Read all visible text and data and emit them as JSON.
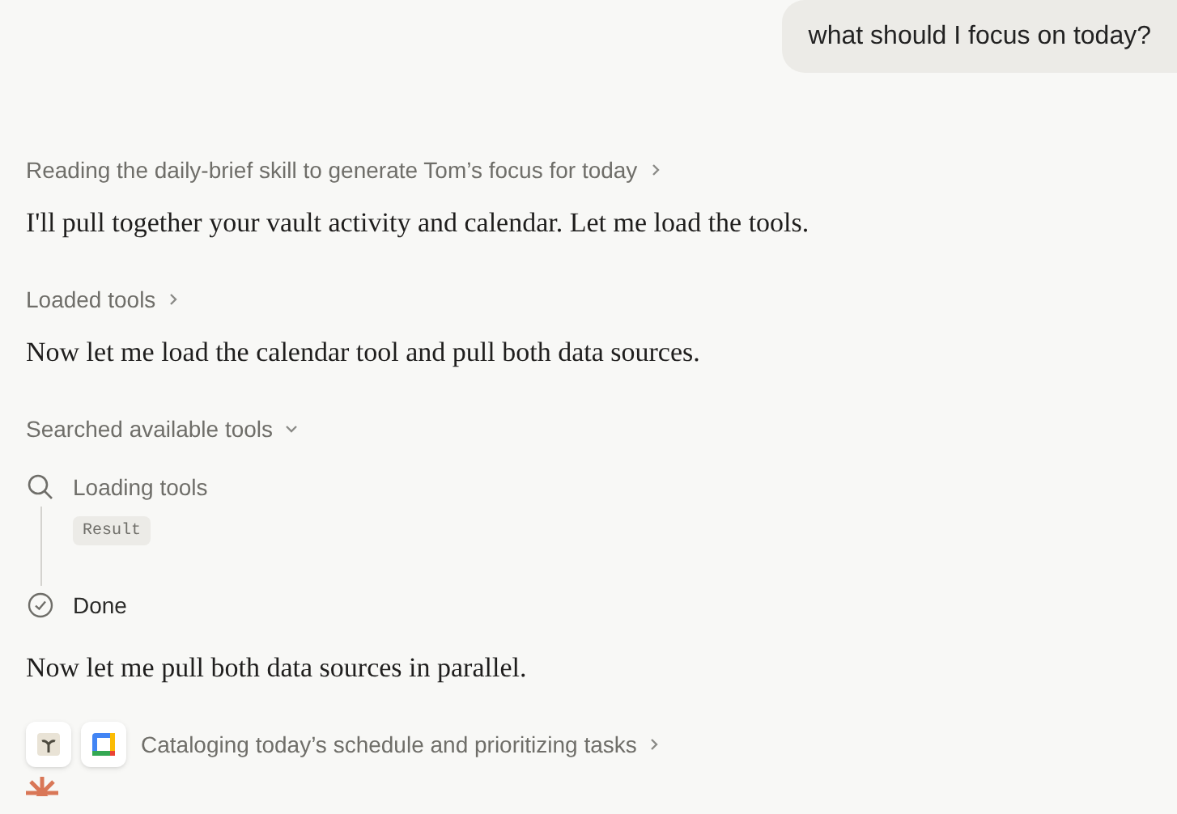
{
  "user_message": "what should I focus on today?",
  "blocks": [
    {
      "kind": "step",
      "label": "Reading the daily-brief skill to generate Tom’s focus for today",
      "expanded": false
    },
    {
      "kind": "message",
      "text": "I'll pull together your vault activity and calendar. Let me load the tools."
    },
    {
      "kind": "step",
      "label": "Loaded tools",
      "expanded": false
    },
    {
      "kind": "message",
      "text": "Now let me load the calendar tool and pull both data sources."
    },
    {
      "kind": "step",
      "label": "Searched available tools",
      "expanded": true
    },
    {
      "kind": "log",
      "entries": [
        {
          "kind": "search",
          "label": "Loading tools",
          "badge": "Result"
        },
        {
          "kind": "done",
          "label": "Done"
        }
      ]
    },
    {
      "kind": "message",
      "text": "Now let me pull both data sources in parallel."
    },
    {
      "kind": "tools",
      "label": "Cataloging today’s schedule and prioritizing tasks",
      "expanded": false
    }
  ]
}
